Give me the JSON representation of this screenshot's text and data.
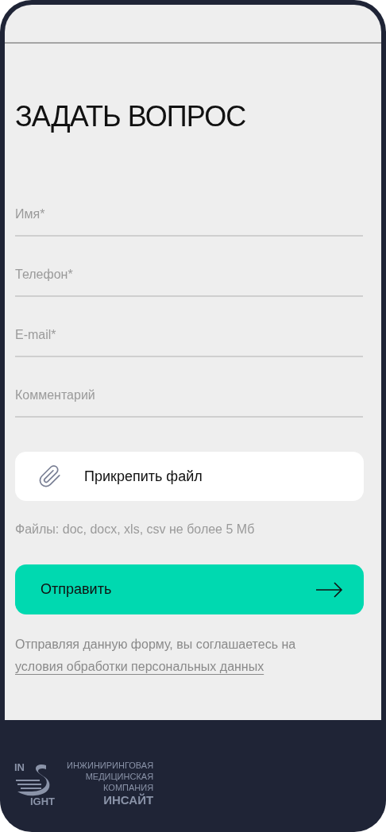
{
  "title": "ЗАДАТЬ ВОПРОС",
  "fields": [
    {
      "placeholder": "Имя*"
    },
    {
      "placeholder": "Телефон*"
    },
    {
      "placeholder": "E-mail*"
    },
    {
      "placeholder": "Комментарий"
    }
  ],
  "attach_button": "Прикрепить файл",
  "file_hint": "Файлы: doc, docx, xls, csv не более 5 Мб",
  "submit_button": "Отправить",
  "consent": {
    "text": "Отправляя данную форму, вы соглашаетесь на",
    "link": "условия обработки персональных данных"
  },
  "footer": {
    "logo_letters": [
      "IN",
      "IGHT"
    ],
    "company_lines": [
      "ИНЖИНИРИНГОВАЯ",
      "МЕДИЦИНСКАЯ",
      "КОМПАНИЯ"
    ],
    "company_name": "ИНСАЙТ"
  }
}
